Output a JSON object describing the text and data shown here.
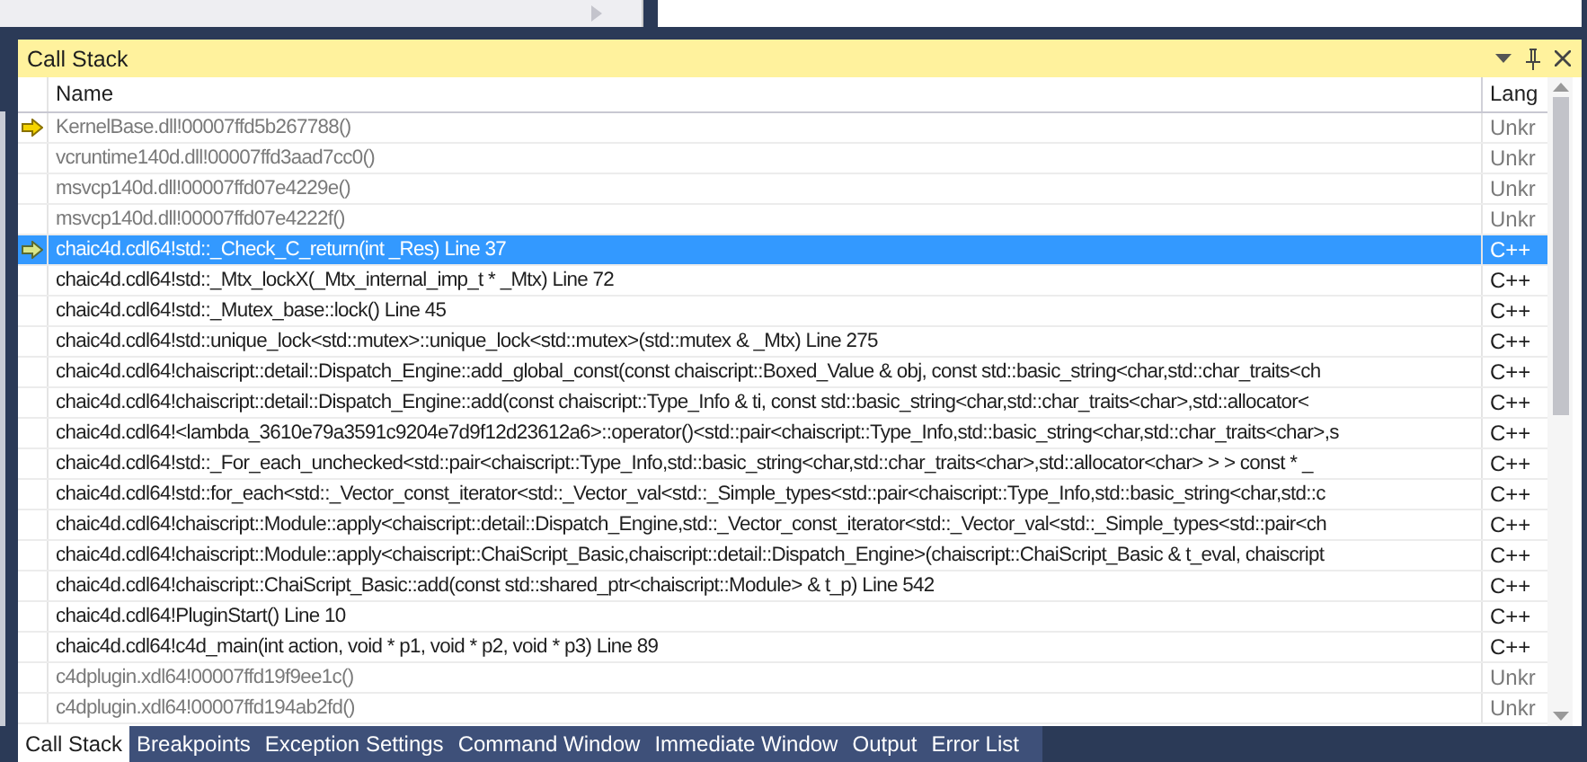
{
  "panel": {
    "title": "Call Stack"
  },
  "table": {
    "columns": [
      "Name",
      "Lang"
    ],
    "rows": [
      {
        "name": "KernelBase.dll!00007ffd5b267788()",
        "lang": "Unkr",
        "external": true,
        "selected": false,
        "current": true
      },
      {
        "name": "vcruntime140d.dll!00007ffd3aad7cc0()",
        "lang": "Unkr",
        "external": true,
        "selected": false
      },
      {
        "name": "msvcp140d.dll!00007ffd07e4229e()",
        "lang": "Unkr",
        "external": true,
        "selected": false
      },
      {
        "name": "msvcp140d.dll!00007ffd07e4222f()",
        "lang": "Unkr",
        "external": true,
        "selected": false
      },
      {
        "name": "chaic4d.cdl64!std::_Check_C_return(int _Res) Line 37",
        "lang": "C++",
        "external": false,
        "selected": true,
        "return_point": true
      },
      {
        "name": "chaic4d.cdl64!std::_Mtx_lockX(_Mtx_internal_imp_t * _Mtx) Line 72",
        "lang": "C++",
        "external": false,
        "selected": false
      },
      {
        "name": "chaic4d.cdl64!std::_Mutex_base::lock() Line 45",
        "lang": "C++",
        "external": false,
        "selected": false
      },
      {
        "name": "chaic4d.cdl64!std::unique_lock<std::mutex>::unique_lock<std::mutex>(std::mutex & _Mtx) Line 275",
        "lang": "C++",
        "external": false,
        "selected": false
      },
      {
        "name": "chaic4d.cdl64!chaiscript::detail::Dispatch_Engine::add_global_const(const chaiscript::Boxed_Value & obj, const std::basic_string<char,std::char_traits<ch",
        "lang": "C++",
        "external": false,
        "selected": false
      },
      {
        "name": "chaic4d.cdl64!chaiscript::detail::Dispatch_Engine::add(const chaiscript::Type_Info & ti, const std::basic_string<char,std::char_traits<char>,std::allocator<",
        "lang": "C++",
        "external": false,
        "selected": false
      },
      {
        "name": "chaic4d.cdl64!<lambda_3610e79a3591c9204e7d9f12d23612a6>::operator()<std::pair<chaiscript::Type_Info,std::basic_string<char,std::char_traits<char>,s",
        "lang": "C++",
        "external": false,
        "selected": false
      },
      {
        "name": "chaic4d.cdl64!std::_For_each_unchecked<std::pair<chaiscript::Type_Info,std::basic_string<char,std::char_traits<char>,std::allocator<char> > > const * _",
        "lang": "C++",
        "external": false,
        "selected": false
      },
      {
        "name": "chaic4d.cdl64!std::for_each<std::_Vector_const_iterator<std::_Vector_val<std::_Simple_types<std::pair<chaiscript::Type_Info,std::basic_string<char,std::c",
        "lang": "C++",
        "external": false,
        "selected": false
      },
      {
        "name": "chaic4d.cdl64!chaiscript::Module::apply<chaiscript::detail::Dispatch_Engine,std::_Vector_const_iterator<std::_Vector_val<std::_Simple_types<std::pair<ch",
        "lang": "C++",
        "external": false,
        "selected": false
      },
      {
        "name": "chaic4d.cdl64!chaiscript::Module::apply<chaiscript::ChaiScript_Basic,chaiscript::detail::Dispatch_Engine>(chaiscript::ChaiScript_Basic & t_eval, chaiscript",
        "lang": "C++",
        "external": false,
        "selected": false
      },
      {
        "name": "chaic4d.cdl64!chaiscript::ChaiScript_Basic::add(const std::shared_ptr<chaiscript::Module> & t_p) Line 542",
        "lang": "C++",
        "external": false,
        "selected": false
      },
      {
        "name": "chaic4d.cdl64!PluginStart() Line 10",
        "lang": "C++",
        "external": false,
        "selected": false
      },
      {
        "name": "chaic4d.cdl64!c4d_main(int action, void * p1, void * p2, void * p3) Line 89",
        "lang": "C++",
        "external": false,
        "selected": false
      },
      {
        "name": "c4dplugin.xdl64!00007ffd19f9ee1c()",
        "lang": "Unkr",
        "external": true,
        "selected": false
      },
      {
        "name": "c4dplugin.xdl64!00007ffd194ab2fd()",
        "lang": "Unkr",
        "external": true,
        "selected": false
      }
    ]
  },
  "tabs": [
    {
      "label": "Call Stack",
      "selected": true
    },
    {
      "label": "Breakpoints",
      "selected": false
    },
    {
      "label": "Exception Settings",
      "selected": false
    },
    {
      "label": "Command Window",
      "selected": false
    },
    {
      "label": "Immediate Window",
      "selected": false
    },
    {
      "label": "Output",
      "selected": false
    },
    {
      "label": "Error List",
      "selected": false
    }
  ]
}
